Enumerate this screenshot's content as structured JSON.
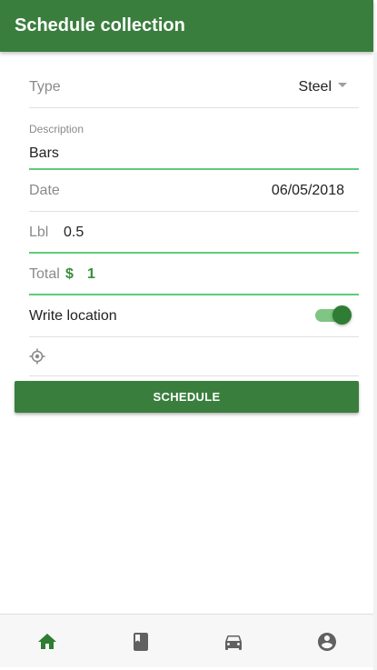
{
  "appbar": {
    "title": "Schedule collection",
    "background": "#3a7e3e"
  },
  "form": {
    "type": {
      "label": "Type",
      "value": "Steel"
    },
    "description": {
      "label": "Description",
      "value": "Bars"
    },
    "date": {
      "label": "Date",
      "value": "06/05/2018"
    },
    "lbl": {
      "label": "Lbl",
      "value": "0.5"
    },
    "total": {
      "label": "Total",
      "currency": "$",
      "value": "1"
    },
    "write_location": {
      "label": "Write location",
      "enabled": true
    },
    "location": {
      "icon": "location-crosshair-icon",
      "value": ""
    }
  },
  "actions": {
    "schedule_label": "SCHEDULE"
  },
  "bottom_nav": {
    "items": [
      {
        "name": "home",
        "icon": "home-icon",
        "active": true
      },
      {
        "name": "book",
        "icon": "book-icon",
        "active": false
      },
      {
        "name": "car",
        "icon": "car-icon",
        "active": false
      },
      {
        "name": "account",
        "icon": "account-circle-icon",
        "active": false
      }
    ],
    "active_color": "#2e7d32",
    "inactive_color": "#616161"
  },
  "colors": {
    "accent": "#3a7e3e",
    "underline_active": "#5fcb7a",
    "total_green": "#3a8e3e"
  }
}
